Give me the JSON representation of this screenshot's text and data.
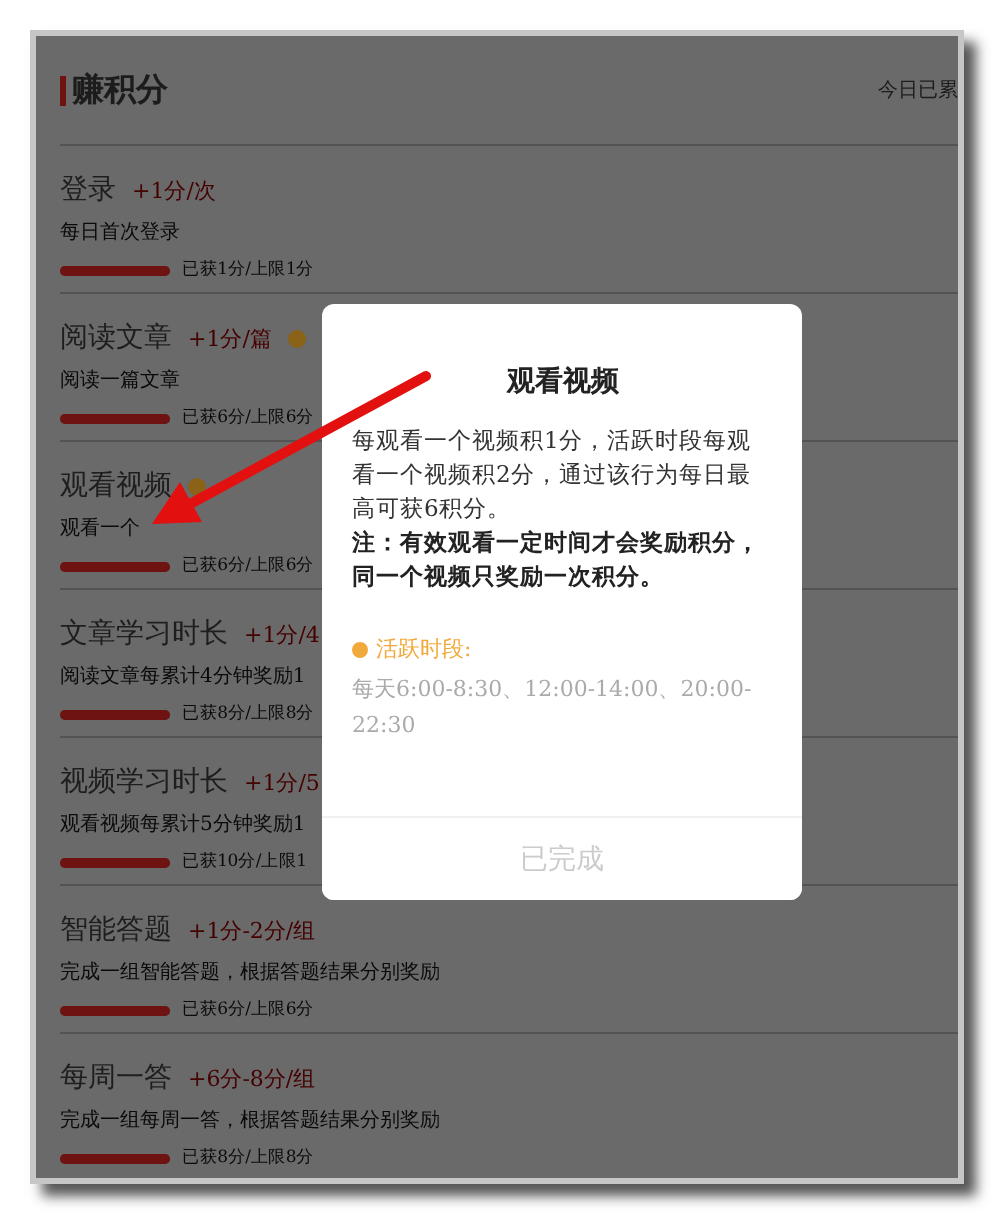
{
  "header": {
    "title": "赚积分",
    "summary": "今日已累"
  },
  "tasks": [
    {
      "title": "登录",
      "points": "+1分/次",
      "active_icon": false,
      "description": "每日首次登录",
      "level": 1,
      "progress": "已获1分/上限1分"
    },
    {
      "title": "阅读文章",
      "points": "+1分/篇",
      "active_icon": true,
      "description": "阅读一篇文章",
      "level": 1,
      "progress": "已获6分/上限6分"
    },
    {
      "title": "观看视频",
      "active_icon": true,
      "description": "观看一个",
      "level": 1,
      "progress": "已获6分/上限6分"
    },
    {
      "title": "文章学习时长",
      "points": "+1分/4",
      "active_icon": false,
      "description": "阅读文章每累计4分钟奖励1",
      "level": 1,
      "progress": "已获8分/上限8分"
    },
    {
      "title": "视频学习时长",
      "points": "+1分/5",
      "active_icon": false,
      "description": "观看视频每累计5分钟奖励1",
      "level": 1,
      "progress": "已获10分/上限1"
    },
    {
      "title": "智能答题",
      "points": "+1分-2分/组",
      "active_icon": false,
      "description": "完成一组智能答题，根据答题结果分别奖励",
      "level": 1,
      "progress": "已获6分/上限6分"
    },
    {
      "title": "每周一答",
      "points": "+6分-8分/组",
      "active_icon": false,
      "description": "完成一组每周一答，根据答题结果分别奖励",
      "level": 1,
      "progress": "已获8分/上限8分"
    }
  ],
  "dialog": {
    "title": "观看视频",
    "body": "每观看一个视频积1分，活跃时段每观看一个视频积2分，通过该行为每日最高可获6积分。",
    "note": "注：有效观看一定时间才会奖励积分，同一个视频只奖励一次积分。",
    "active_label": "活跃时段:",
    "active_times": "每天6:00-8:30、12:00-14:00、20:00-22:30",
    "button": "已完成",
    "button_disabled": true
  }
}
